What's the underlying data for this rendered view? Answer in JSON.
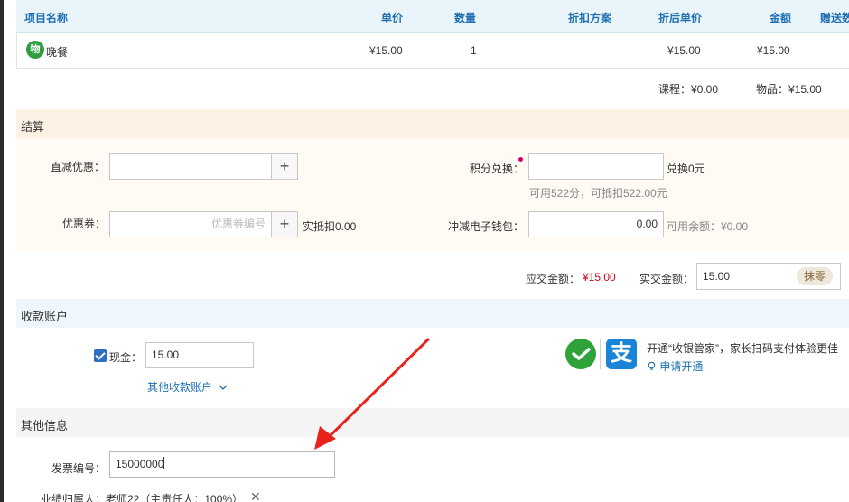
{
  "table": {
    "headers": [
      "项目名称",
      "单价",
      "数量",
      "折扣方案",
      "折后单价",
      "金额",
      "赠送数"
    ],
    "row": {
      "badge": "物",
      "name": "晚餐",
      "price": "¥15.00",
      "qty": "1",
      "discount_plan": "",
      "discounted_price": "¥15.00",
      "amount": "¥15.00"
    }
  },
  "summary": {
    "course": "课程：¥0.00",
    "goods": "物品：¥15.00"
  },
  "settlement": {
    "title": "结算",
    "direct_discount_label": "直减优惠：",
    "direct_discount_value": "",
    "points_label": "积分兑换：",
    "points_value": "",
    "points_exchange_text": "兑换0元",
    "points_hint": "可用522分，可抵扣522.00元",
    "coupon_label": "优惠券：",
    "coupon_placeholder": "优惠券编号",
    "coupon_deduct_text": "实抵扣0.00",
    "wallet_label": "冲减电子钱包：",
    "wallet_value": "0.00",
    "wallet_hint": "可用余额：¥0.00",
    "payable_label": "应交金额：",
    "payable_value": "¥15.00",
    "actual_label": "实交金额：",
    "actual_value": "15.00",
    "round_btn": "抹零",
    "plus_symbol": "+"
  },
  "accounts": {
    "title": "收款账户",
    "cash_label": "现金：",
    "cash_value": "15.00",
    "other_accounts": "其他收款账户",
    "promo_text": "开通“收银管家”，家长扫码支付体验更佳",
    "apply_link": "申请开通",
    "alipay_glyph": "支"
  },
  "other": {
    "title": "其他信息",
    "invoice_label": "发票编号：",
    "invoice_value": "15000000",
    "performance_text": "业绩归属人：老师22（主责任人：100%）"
  },
  "colors": {
    "accent_blue": "#1f6fb3",
    "red_amount": "#d0021b",
    "annotation_arrow": "#e8231c"
  }
}
